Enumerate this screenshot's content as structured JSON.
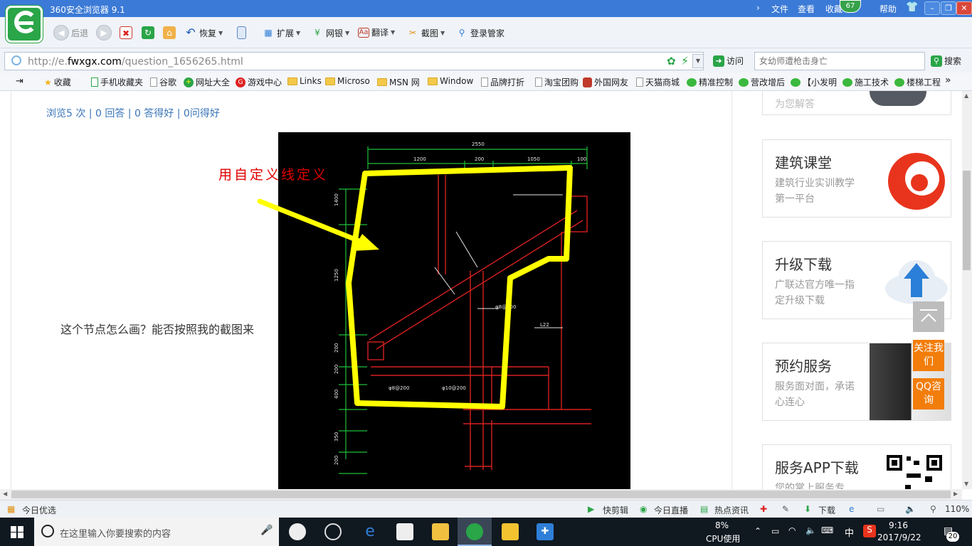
{
  "window": {
    "title": "360安全浏览器 9.1",
    "badge": "67"
  },
  "menu": {
    "file": "文件",
    "view": "查看",
    "favorites": "收藏",
    "help": "帮助"
  },
  "window_buttons": {
    "minimize": "–",
    "restore": "❐",
    "close": "✕"
  },
  "toolbar": {
    "back": "后退",
    "restore": "恢复",
    "extensions": "扩展",
    "bank": "网银",
    "translate": "翻译",
    "screenshot": "截图",
    "login_manager": "登录管家"
  },
  "address": {
    "prefix": "http://e.",
    "domain": "fwxgx.com",
    "path": "/question_1656265.html",
    "visit": "访问",
    "search_placeholder": "女幼师遭枪击身亡",
    "search_button": "搜索"
  },
  "favorites": {
    "collect": "收藏",
    "items": [
      "手机收藏夹",
      "谷歌",
      "网址大全",
      "游戏中心",
      "Links",
      "Microso",
      "MSN 网",
      "Window",
      "品牌打折",
      "淘宝团购",
      "外国网友",
      "天猫商城",
      "精准控制",
      "营改增后",
      "【小发明",
      "施工技术",
      "楼梯工程"
    ],
    "more": "»"
  },
  "page": {
    "stats": "浏览5 次 | 0 回答 | 0 答得好 | 0问得好",
    "question": "这个节点怎么画？能否按照我的截图来",
    "annotation": "用自定义线定义"
  },
  "cad_labels": {
    "top_total": "2550",
    "d1": "1200",
    "d2": "200",
    "d3": "1050",
    "d4": "100",
    "l1": "1400",
    "l2": "1250",
    "l3": "200",
    "l4": "200",
    "l5": "400",
    "l6": "350",
    "l7": "200",
    "lb": "L22",
    "rebar1": "φ8@200",
    "rebar2": "φ10@200",
    "rebar3": "φ8@200"
  },
  "sidebar": {
    "top_partial": "为您解答",
    "cards": [
      {
        "title": "建筑课堂",
        "desc": "建筑行业实训教学第一平台"
      },
      {
        "title": "升级下载",
        "desc": "广联达官方唯一指定升级下载"
      },
      {
        "title": "预约服务",
        "desc": "服务面对面，承诺心连心"
      },
      {
        "title": "服务APP下载",
        "desc": "您的掌上服务专"
      }
    ],
    "follow": "关注我们",
    "qq": "QQ咨询"
  },
  "statusbar": {
    "today": "今日优选",
    "quick_cut": "快剪辑",
    "live": "今日直播",
    "hot": "热点资讯",
    "download": "下载",
    "zoom": "110%"
  },
  "taskbar": {
    "search_placeholder": "在这里输入你要搜索的内容",
    "cpu_value": "8%",
    "cpu_label": "CPU使用",
    "ime": "中",
    "time": "9:16",
    "date": "2017/9/22",
    "notifications": "20"
  },
  "colors": {
    "titlebar": "#3b7ad6",
    "highlight": "#ffff00",
    "annotation": "#e00000",
    "accent": "#f27d0a"
  }
}
